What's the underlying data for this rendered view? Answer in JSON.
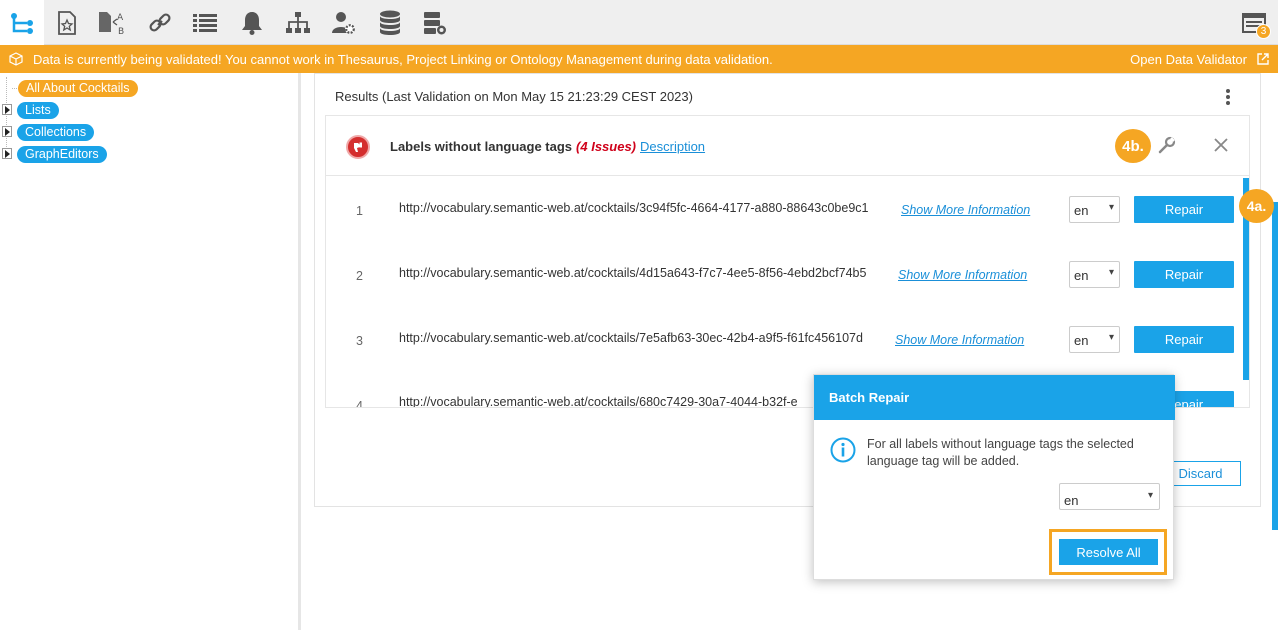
{
  "toolbar": {
    "icons": [
      "hierarchy-icon",
      "favorite-document-icon",
      "translate-icon",
      "link-icon",
      "list-icon",
      "bell-icon",
      "sitemap-icon",
      "user-settings-icon",
      "database-icon",
      "database-server-icon"
    ],
    "notification_count": "3"
  },
  "banner": {
    "message": "Data is currently being validated! You cannot work in Thesaurus, Project Linking or Ontology Management during data validation.",
    "link": "Open Data Validator",
    "color": "#f5a623"
  },
  "tree": {
    "items": [
      {
        "label": "All About Cocktails",
        "color": "#f5a623"
      },
      {
        "label": "Lists",
        "color": "#1aa3e8"
      },
      {
        "label": "Collections",
        "color": "#1aa3e8"
      },
      {
        "label": "GraphEditors",
        "color": "#1aa3e8"
      }
    ]
  },
  "results": {
    "label": "Results",
    "last_validation": "(Last Validation on Mon May 15 21:23:29 CEST 2023)"
  },
  "issue": {
    "title": "Labels without language tags",
    "count": "(4 Issues)",
    "description_link": "Description",
    "badge_4b": "4b.",
    "badge_4a": "4a."
  },
  "rows": [
    {
      "num": "1",
      "uri": "http://vocabulary.semantic-web.at/cocktails/3c94f5fc-4664-4177-a880-88643c0be9c1",
      "more": "Show More Information",
      "lang": "en",
      "repair": "Repair"
    },
    {
      "num": "2",
      "uri": "http://vocabulary.semantic-web.at/cocktails/4d15a643-f7c7-4ee5-8f56-4ebd2bcf74b5",
      "more": "Show More Information",
      "lang": "en",
      "repair": "Repair"
    },
    {
      "num": "3",
      "uri": "http://vocabulary.semantic-web.at/cocktails/7e5afb63-30ec-42b4-a9f5-f61fc456107d",
      "more": "Show More Information",
      "lang": "en",
      "repair": "Repair"
    },
    {
      "num": "4",
      "uri": "http://vocabulary.semantic-web.at/cocktails/680c7429-30a7-4044-b32f-e",
      "more": "",
      "lang": "",
      "repair": "Repair"
    }
  ],
  "discard_label": "Discard",
  "modal": {
    "title": "Batch Repair",
    "text": "For all labels without language tags the selected language tag will be added.",
    "lang": "en",
    "resolve_label": "Resolve All"
  }
}
